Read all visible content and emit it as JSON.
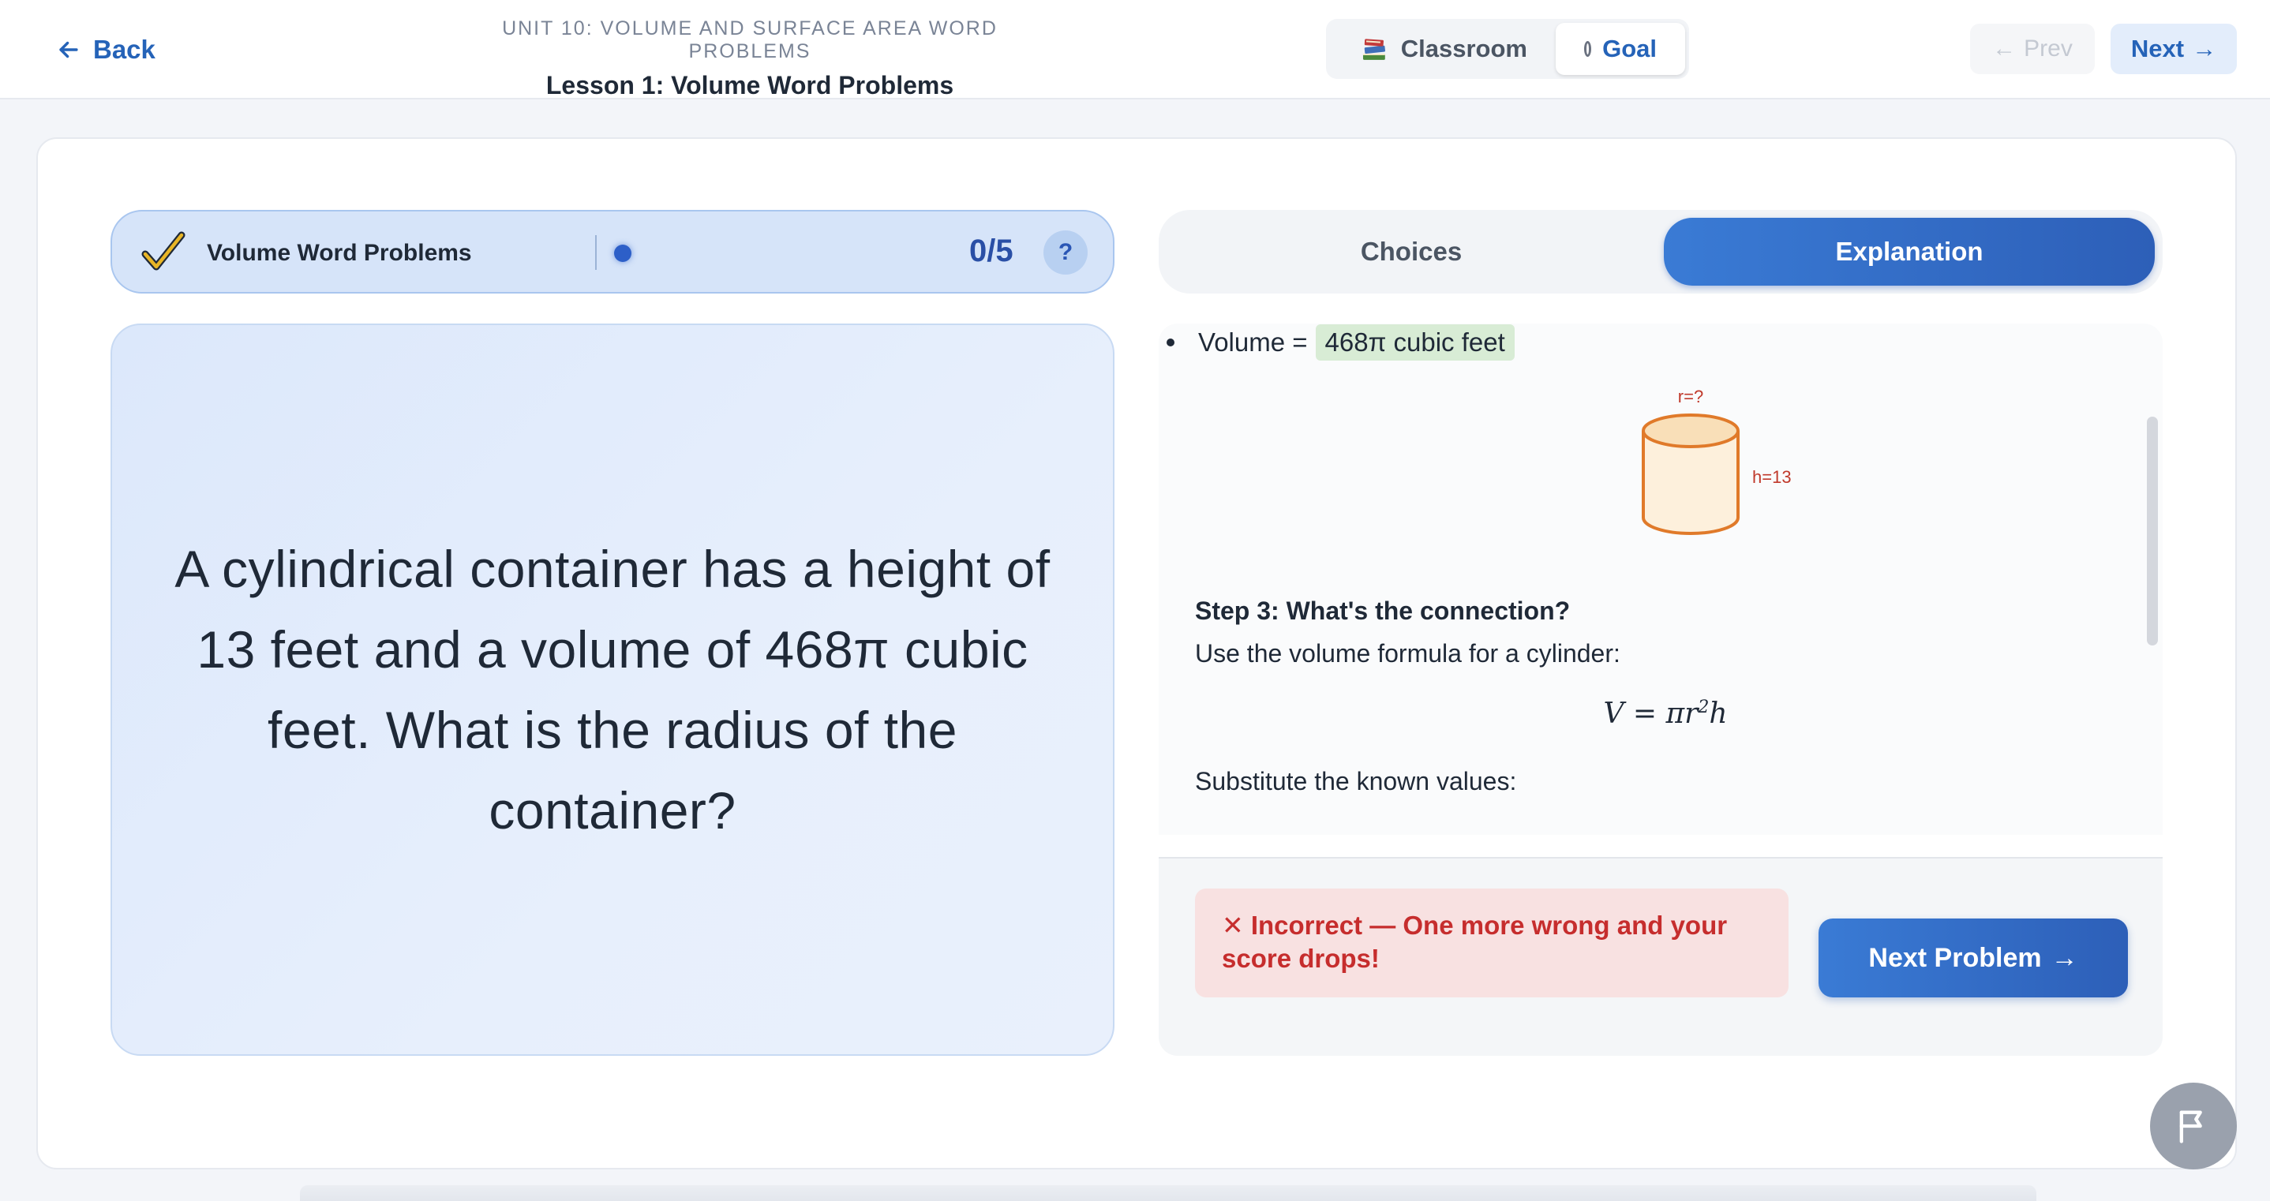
{
  "topbar": {
    "back_label": "Back",
    "unit_title": "UNIT 10: VOLUME AND SURFACE AREA WORD PROBLEMS",
    "lesson_title": "Lesson 1: Volume Word Problems",
    "mode_classroom": "Classroom",
    "mode_goal": "Goal",
    "prev_label": "Prev",
    "next_label": "Next"
  },
  "progress": {
    "label": "Volume Word Problems",
    "score": "0/5",
    "help": "?"
  },
  "question": {
    "text": "A cylindrical container has a height of 13 feet and a volume of 468π cubic feet. What is the radius of the container?"
  },
  "tabs": {
    "choices": "Choices",
    "explanation": "Explanation"
  },
  "explanation": {
    "bullet_prefix": "Volume =",
    "bullet_value": "468π cubic feet",
    "diagram_radius_label": "r=?",
    "diagram_height_label": "h=13",
    "step_title": "Step 3: What's the connection?",
    "step_text": "Use the volume formula for a cylinder:",
    "formula_lhs": "V",
    "formula_rhs": "= πr",
    "formula_exp": "2",
    "formula_tail": "h",
    "substitute_text": "Substitute the known values:"
  },
  "feedback": {
    "incorrect_line1": "✕ Incorrect — One more wrong and your",
    "incorrect_line2": "score drops!",
    "next_problem": "Next Problem"
  },
  "colors": {
    "accent": "#2563b8",
    "incorrect": "#c62d2d",
    "highlight": "#d8ecd5",
    "diagram_stroke": "#e07a2a"
  }
}
